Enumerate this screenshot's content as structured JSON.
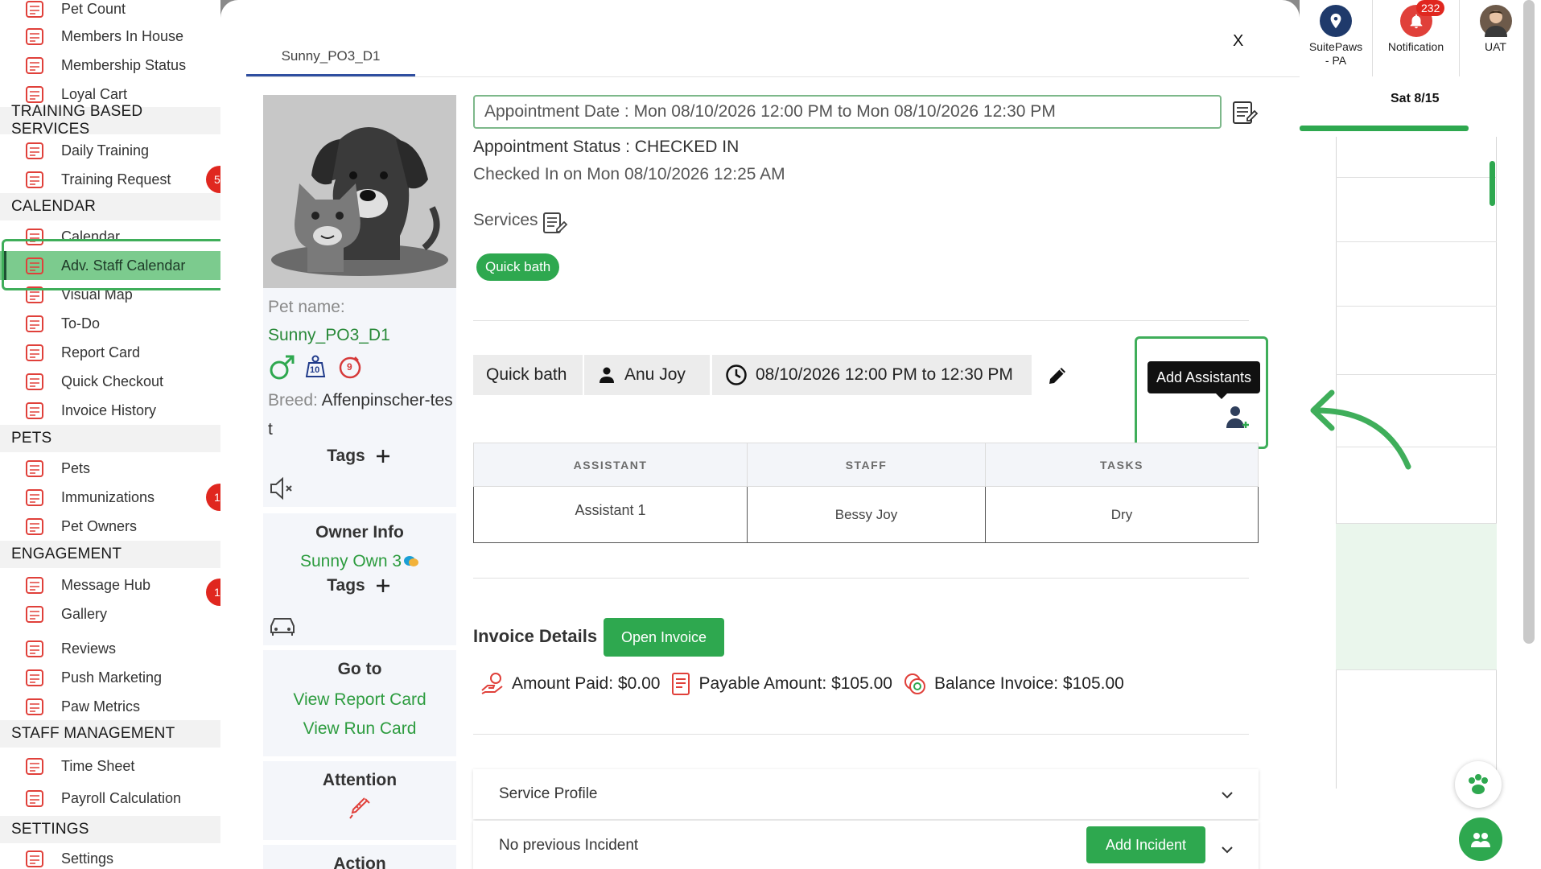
{
  "sidebar": {
    "items": [
      {
        "label": "Pet Count",
        "icon": "paw-counter-icon"
      },
      {
        "label": "Members In House",
        "icon": "house-members-icon"
      },
      {
        "label": "Membership Status",
        "icon": "membership-list-icon"
      },
      {
        "label": "Loyal Cart",
        "icon": "loyal-cart-icon"
      },
      {
        "section": "TRAINING BASED SERVICES"
      },
      {
        "label": "Daily Training",
        "icon": "daily-training-icon"
      },
      {
        "label": "Training Request",
        "icon": "training-request-icon"
      },
      {
        "section": "CALENDAR"
      },
      {
        "label": "Calendar",
        "icon": "calendar-icon"
      },
      {
        "label": "Adv. Staff Calendar",
        "icon": "staff-calendar-icon"
      },
      {
        "label": "Visual Map",
        "icon": "visual-map-icon"
      },
      {
        "label": "To-Do",
        "icon": "todo-icon"
      },
      {
        "label": "Report Card",
        "icon": "report-card-icon"
      },
      {
        "label": "Quick Checkout",
        "icon": "cart-icon"
      },
      {
        "label": "Invoice History",
        "icon": "invoice-history-icon"
      },
      {
        "section": "PETS"
      },
      {
        "label": "Pets",
        "icon": "paw-icon"
      },
      {
        "label": "Immunizations",
        "icon": "shield-icon"
      },
      {
        "label": "Pet Owners",
        "icon": "person-icon"
      },
      {
        "section": "ENGAGEMENT"
      },
      {
        "label": "Message Hub",
        "icon": "chat-icon"
      },
      {
        "label": "Gallery",
        "icon": "gallery-icon"
      },
      {
        "label": "Reviews",
        "icon": "thumbs-up-icon"
      },
      {
        "label": "Push Marketing",
        "icon": "rocket-icon"
      },
      {
        "label": "Paw Metrics",
        "icon": "metrics-icon"
      },
      {
        "section": "STAFF MANAGEMENT"
      },
      {
        "label": "Time Sheet",
        "icon": "timesheet-icon"
      },
      {
        "label": "Payroll Calculation",
        "icon": "payroll-icon"
      },
      {
        "section": "SETTINGS"
      },
      {
        "label": "Settings",
        "icon": "tools-icon"
      }
    ],
    "badges": [
      "5",
      "1",
      "1"
    ]
  },
  "topbar": {
    "location": "SuitePaws - PA",
    "notification_label": "Notification",
    "notification_count": "232",
    "user_label": "UAT"
  },
  "calendar": {
    "day_label": "Sat 8/15"
  },
  "modal": {
    "tab_label": "Sunny_PO3_D1",
    "close_label": "X",
    "pet": {
      "name_label": "Pet name:",
      "name": "Sunny_PO3_D1",
      "weight_value": "10",
      "age_value": "9",
      "breed_label": "Breed:",
      "breed": "Affenpinscher-test",
      "tags_label": "Tags"
    },
    "owner": {
      "title": "Owner Info",
      "name": "Sunny Own 3",
      "tags_label": "Tags"
    },
    "goto": {
      "title": "Go to",
      "report_card": "View Report Card",
      "run_card": "View Run Card"
    },
    "attention_title": "Attention",
    "action_title": "Action",
    "appointment": {
      "date_text": "Appointment Date : Mon 08/10/2026 12:00 PM to Mon 08/10/2026 12:30 PM",
      "status_text": "Appointment Status : CHECKED IN",
      "checked_in_text": "Checked In on Mon 08/10/2026 12:25 AM",
      "services_label": "Services",
      "service_pill": "Quick bath"
    },
    "service_line": {
      "service": "Quick bath",
      "staff": "Anu Joy",
      "time": "08/10/2026 12:00 PM to 12:30 PM",
      "add_assistants_tooltip": "Add Assistants"
    },
    "assistants_table": {
      "headers": [
        "ASSISTANT",
        "STAFF",
        "TASKS"
      ],
      "rows": [
        [
          "Assistant 1",
          "Bessy Joy",
          "Dry"
        ]
      ]
    },
    "invoice": {
      "title": "Invoice Details",
      "open_button": "Open Invoice",
      "amount_paid": "Amount Paid: $0.00",
      "payable_amount": "Payable Amount: $105.00",
      "balance_invoice": "Balance Invoice: $105.00"
    },
    "service_profile_label": "Service Profile",
    "incident_label": "No previous Incident",
    "add_incident_button": "Add Incident"
  },
  "colors": {
    "accent_green": "#2ea84f",
    "highlight_green": "#3fae5a",
    "badge_red": "#e0271f",
    "tab_underline": "#2f4ea0"
  }
}
